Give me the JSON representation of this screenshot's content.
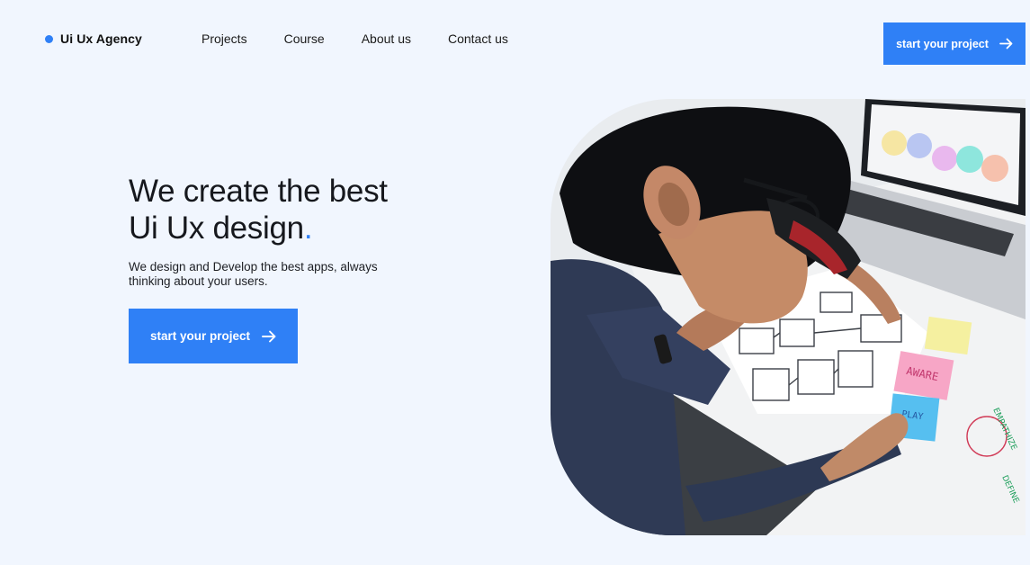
{
  "brand": {
    "name": "Ui Ux Agency",
    "dot_color": "#2f80f6"
  },
  "nav": {
    "items": [
      "Projects",
      "Course",
      "About us",
      "Contact us"
    ]
  },
  "header_cta": {
    "label": "start your project",
    "icon": "arrow-right-icon"
  },
  "hero": {
    "title_line1": "We create the best",
    "title_line2": "Ui Ux design",
    "title_dot": ".",
    "subtitle": "We design and Develop the best apps, always thinking about your users.",
    "cta_label": "start your project",
    "cta_icon": "arrow-right-icon"
  },
  "image": {
    "description": "designer-sketching-wireframes-photo",
    "sticky_notes": [
      "AWARE",
      "PLAY"
    ],
    "side_labels": [
      "EMPATHIZE",
      "DEFINE"
    ]
  },
  "colors": {
    "accent": "#2f80f6",
    "background": "#f1f6fe",
    "text": "#16181d"
  }
}
